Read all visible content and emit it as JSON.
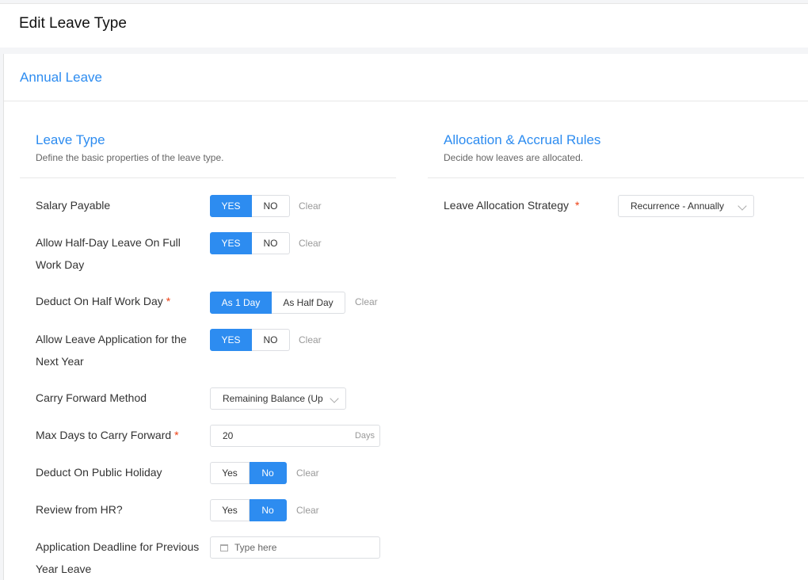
{
  "header": {
    "title": "Edit Leave Type"
  },
  "card": {
    "title": "Annual Leave"
  },
  "left": {
    "title": "Leave Type",
    "subtitle": "Define the basic properties of the leave type.",
    "fields": {
      "salary": {
        "label": "Salary Payable",
        "opt1": "YES",
        "opt2": "NO",
        "clear": "Clear"
      },
      "halfday": {
        "label_line1": "Allow Half-Day Leave On Full",
        "label_line2": "Work Day",
        "opt1": "YES",
        "opt2": "NO",
        "clear": "Clear"
      },
      "deduct_half": {
        "label": "Deduct On Half Work Day",
        "required": "*",
        "opt1": "As 1 Day",
        "opt2": "As Half Day",
        "clear": "Clear"
      },
      "next_year": {
        "label_line1": "Allow Leave Application for the",
        "label_line2": "Next Year",
        "opt1": "YES",
        "opt2": "NO",
        "clear": "Clear"
      },
      "carry_method": {
        "label": "Carry Forward Method",
        "value": "Remaining Balance (Up"
      },
      "max_days": {
        "label": "Max Days to Carry Forward",
        "required": "*",
        "value": "20",
        "suffix": "Days"
      },
      "public_holiday": {
        "label": "Deduct On Public Holiday",
        "opt1": "Yes",
        "opt2": "No",
        "clear": "Clear"
      },
      "review_hr": {
        "label": "Review from HR?",
        "opt1": "Yes",
        "opt2": "No",
        "clear": "Clear"
      },
      "deadline": {
        "label_line1": "Application Deadline for Previous",
        "label_line2": "Year Leave",
        "placeholder": "Type here"
      }
    }
  },
  "right": {
    "title": "Allocation & Accrual Rules",
    "subtitle": "Decide how leaves are allocated.",
    "strategy": {
      "label": "Leave Allocation Strategy",
      "required": "*",
      "value": "Recurrence - Annually"
    }
  },
  "colors": {
    "accent": "#2d8cf0",
    "required": "#ed4014"
  }
}
